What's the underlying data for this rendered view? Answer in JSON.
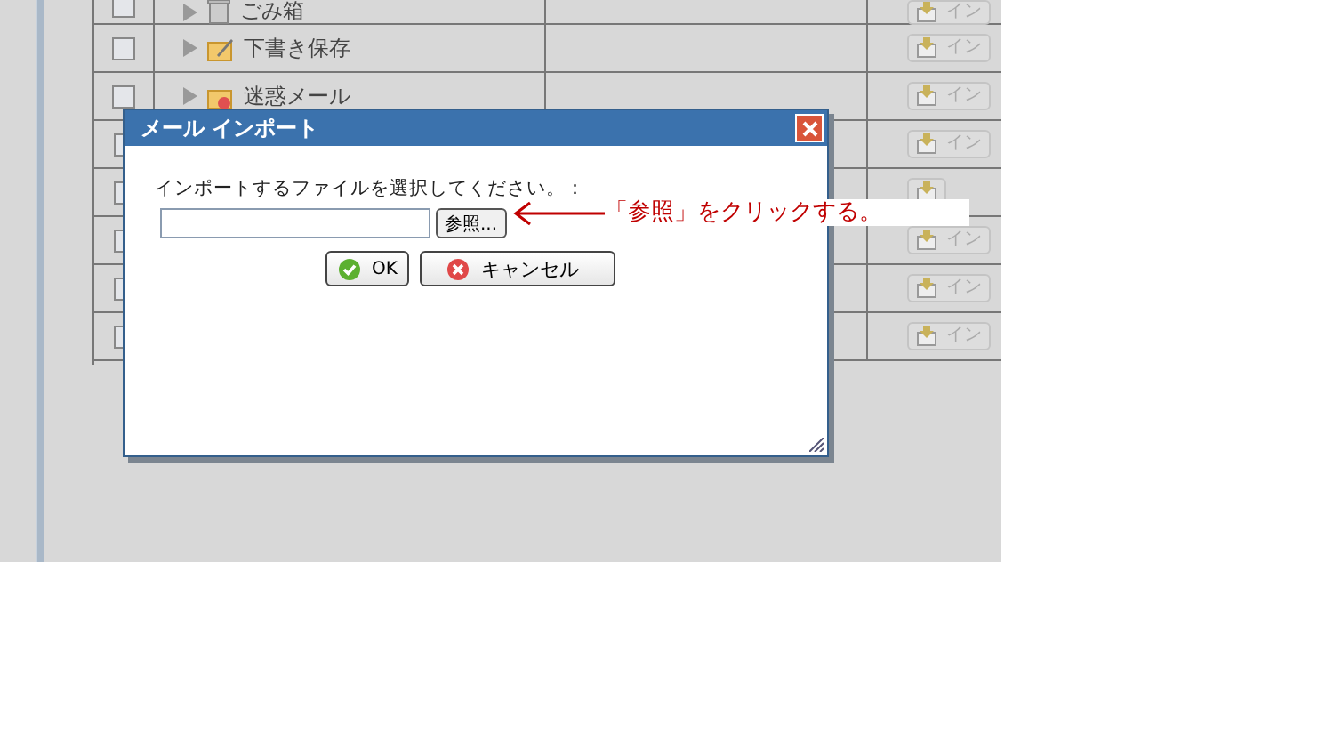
{
  "folders": {
    "rows": [
      {
        "kind": "trash",
        "name": "ごみ箱",
        "checked": false,
        "import_button": "イン"
      },
      {
        "kind": "draft",
        "name": "下書き保存",
        "checked": false,
        "import_button": "イン"
      },
      {
        "kind": "spam",
        "name": "迷惑メール",
        "checked": false,
        "import_button": "イン"
      },
      {
        "checked": false,
        "import_button": "イン"
      },
      {
        "checked": false
      },
      {
        "checked": false,
        "import_button": "イン"
      },
      {
        "checked": false,
        "import_button": "イン"
      },
      {
        "checked": false,
        "import_button": "イン"
      }
    ]
  },
  "dialog": {
    "title": "メール インポート",
    "prompt": "インポートするファイルを選択してください。：",
    "browse_button": "参照...",
    "ok_button": "OK",
    "cancel_button": "キャンセル"
  },
  "annotation": {
    "text": "「参照」をクリックする。"
  }
}
